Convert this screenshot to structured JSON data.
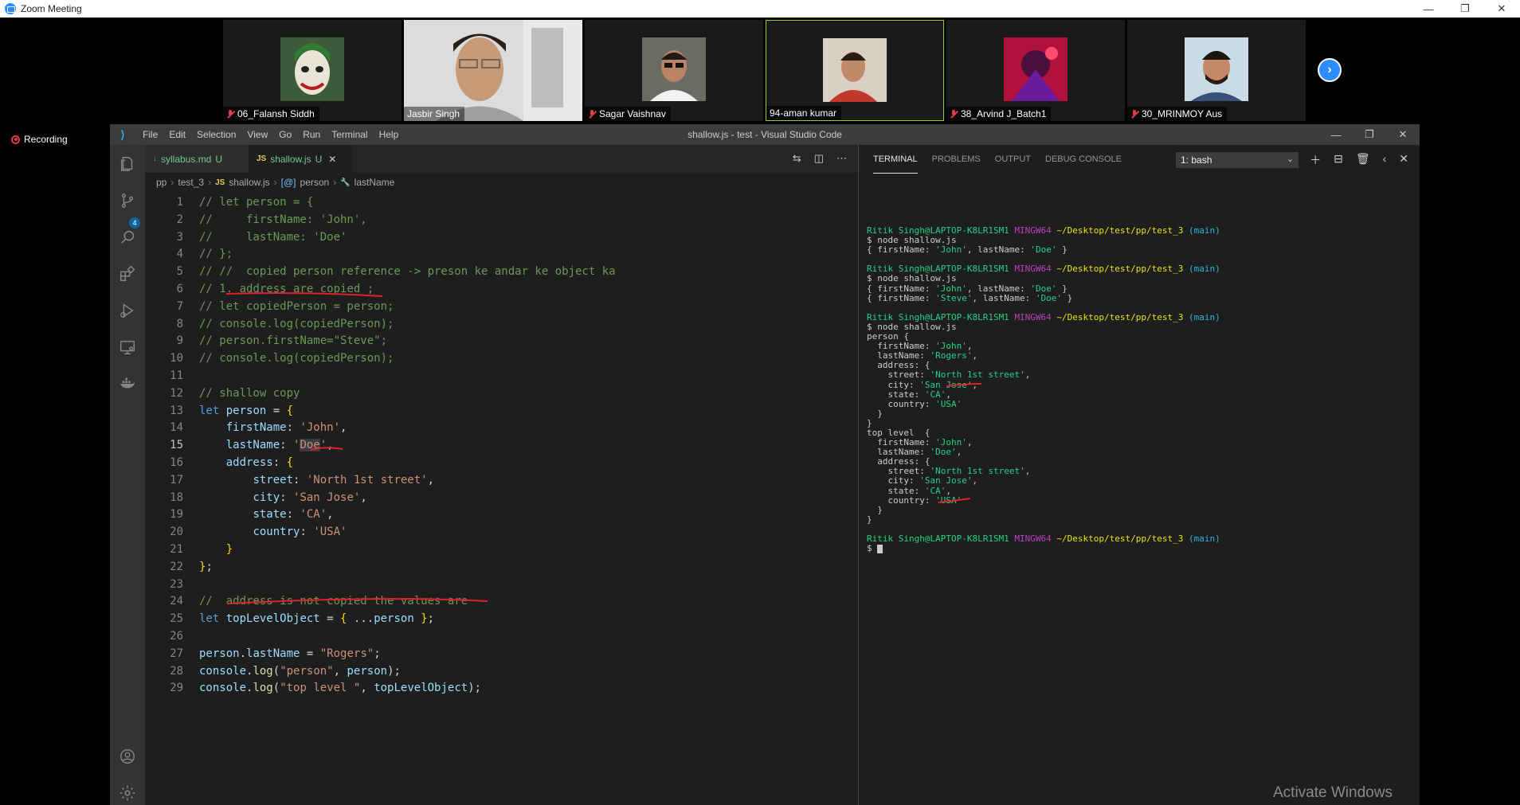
{
  "zoom": {
    "title": "Zoom Meeting",
    "recording_label": "Recording",
    "participants": [
      {
        "name": "06_Falansh Siddh",
        "muted": true
      },
      {
        "name": "Jasbir Singh",
        "muted": false
      },
      {
        "name": "Sagar Vaishnav",
        "muted": true
      },
      {
        "name": "94-aman kumar",
        "muted": false
      },
      {
        "name": "38_Arvind J_Batch1",
        "muted": true
      },
      {
        "name": "30_MRINMOY Aus",
        "muted": true
      }
    ]
  },
  "vscode": {
    "menu": [
      "File",
      "Edit",
      "Selection",
      "View",
      "Go",
      "Run",
      "Terminal",
      "Help"
    ],
    "window_title": "shallow.js - test - Visual Studio Code",
    "scm_badge": "4",
    "tabs": [
      {
        "icon": "↓",
        "label": "syllabus.md",
        "status": "U"
      },
      {
        "icon": "JS",
        "label": "shallow.js",
        "status": "U"
      }
    ],
    "breadcrumb": [
      "pp",
      "test_3",
      "shallow.js",
      "person",
      "lastName"
    ],
    "breadcrumb_icons": [
      "JS",
      "[@]",
      "🔧"
    ],
    "panel_tabs": [
      "TERMINAL",
      "PROBLEMS",
      "OUTPUT",
      "DEBUG CONSOLE"
    ],
    "terminal_select": "1: bash",
    "code_lines": [
      "// let person = {",
      "//     firstName: 'John',",
      "//     lastName: 'Doe'",
      "// };",
      "// //  copied person reference -> preson ke andar ke object ka",
      "// 1. address are copied ;",
      "// let copiedPerson = person;",
      "// console.log(copiedPerson);",
      "// person.firstName=\"Steve\";",
      "// console.log(copiedPerson);",
      "",
      "// shallow copy",
      "let person = {",
      "    firstName: 'John',",
      "    lastName: 'Doe',",
      "    address: {",
      "        street: 'North 1st street',",
      "        city: 'San Jose',",
      "        state: 'CA',",
      "        country: 'USA'",
      "    }",
      "};",
      "",
      "//  address is not copied the values are",
      "let topLevelObject = { ...person };",
      "",
      "person.lastName = \"Rogers\";",
      "console.log(\"person\", person);",
      "console.log(\"top level \", topLevelObject);"
    ],
    "line_numbers": [
      "1",
      "2",
      "3",
      "4",
      "5",
      "6",
      "7",
      "8",
      "9",
      "10",
      "11",
      "12",
      "13",
      "14",
      "15",
      "16",
      "17",
      "18",
      "19",
      "20",
      "21",
      "22",
      "23",
      "24",
      "25",
      "26",
      "27",
      "28",
      "29"
    ],
    "terminal": {
      "prompt_user": "Ritik Singh@LAPTOP-K8LR1SM1",
      "prompt_env": "MINGW64",
      "prompt_path": "~/Desktop/test/pp/test_3",
      "prompt_branch": "(main)",
      "cmd": "$ node shallow.js",
      "out1": "{ firstName: 'John', lastName: 'Doe' }",
      "out2a": "{ firstName: 'John', lastName: 'Doe' }",
      "out2b": "{ firstName: 'Steve', lastName: 'Doe' }",
      "block3": [
        "person {",
        "  firstName: 'John',",
        "  lastName: 'Rogers',",
        "  address: {",
        "    street: 'North 1st street',",
        "    city: 'San Jose',",
        "    state: 'CA',",
        "    country: 'USA'",
        "  }",
        "}",
        "top level  {",
        "  firstName: 'John',",
        "  lastName: 'Doe',",
        "  address: {",
        "    street: 'North 1st street',",
        "    city: 'San Jose',",
        "    state: 'CA',",
        "    country: 'USA'",
        "  }",
        "}"
      ],
      "final_prompt": "$ "
    }
  },
  "watermark": "Activate Windows",
  "colors": {
    "zoom_blue": "#2d8cff",
    "active_speaker": "#9ccc2c",
    "annotation_red": "#e0202a"
  }
}
